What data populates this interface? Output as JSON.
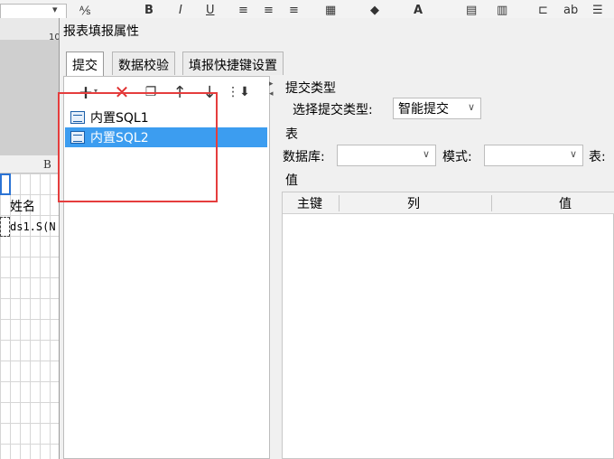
{
  "background_app": {
    "ruler_number": "10",
    "column_header": "B",
    "cell_name": "姓名",
    "cell_ds": "ds1.S(N"
  },
  "dialog": {
    "title": "报表填报属性",
    "tabs": [
      {
        "label": "提交",
        "active": true
      },
      {
        "label": "数据校验",
        "active": false
      },
      {
        "label": "填报快捷键设置",
        "active": false
      }
    ],
    "toolbar_icons": [
      "add-icon",
      "delete-icon",
      "copy-icon",
      "move-up-icon",
      "move-down-icon",
      "sort-icon"
    ],
    "list": [
      {
        "label": "内置SQL1",
        "selected": false
      },
      {
        "label": "内置SQL2",
        "selected": true
      }
    ],
    "submit_type": {
      "section": "提交类型",
      "select_label": "选择提交类型:",
      "value": "智能提交"
    },
    "table_section": {
      "section": "表",
      "database_label": "数据库:",
      "database_value": "",
      "schema_label": "模式:",
      "schema_value": "",
      "table_label": "表:"
    },
    "value_section": {
      "section": "值",
      "columns": [
        "主键",
        "列",
        "值"
      ]
    }
  },
  "colors": {
    "selection": "#3c9df0",
    "highlight_box": "#e53d3d",
    "delete_icon": "#e03030"
  }
}
